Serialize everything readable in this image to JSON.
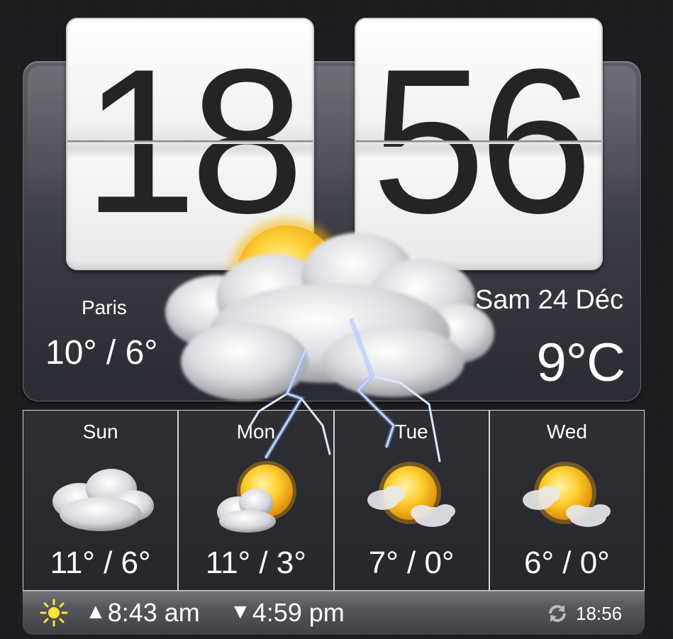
{
  "clock": {
    "hours": "18",
    "minutes": "56"
  },
  "current": {
    "city": "Paris",
    "high_low": "10° / 6°",
    "date": "Sam 24 Déc",
    "temperature": "9°C",
    "icon": "thunderstorm-partly-sunny-icon"
  },
  "forecast": [
    {
      "day": "Sun",
      "temps": "11° / 6°",
      "icon": "cloudy-icon"
    },
    {
      "day": "Mon",
      "temps": "11° / 3°",
      "icon": "partly-cloudy-icon"
    },
    {
      "day": "Tue",
      "temps": "7° / 0°",
      "icon": "mostly-sunny-icon"
    },
    {
      "day": "Wed",
      "temps": "6° / 0°",
      "icon": "mostly-sunny-icon"
    }
  ],
  "bottom_bar": {
    "sunrise": "8:43 am",
    "sunset": "4:59 pm",
    "last_update": "18:56"
  },
  "colors": {
    "sun": "#f5c32a",
    "digits": "#242424",
    "panel": "#3a3b43"
  }
}
